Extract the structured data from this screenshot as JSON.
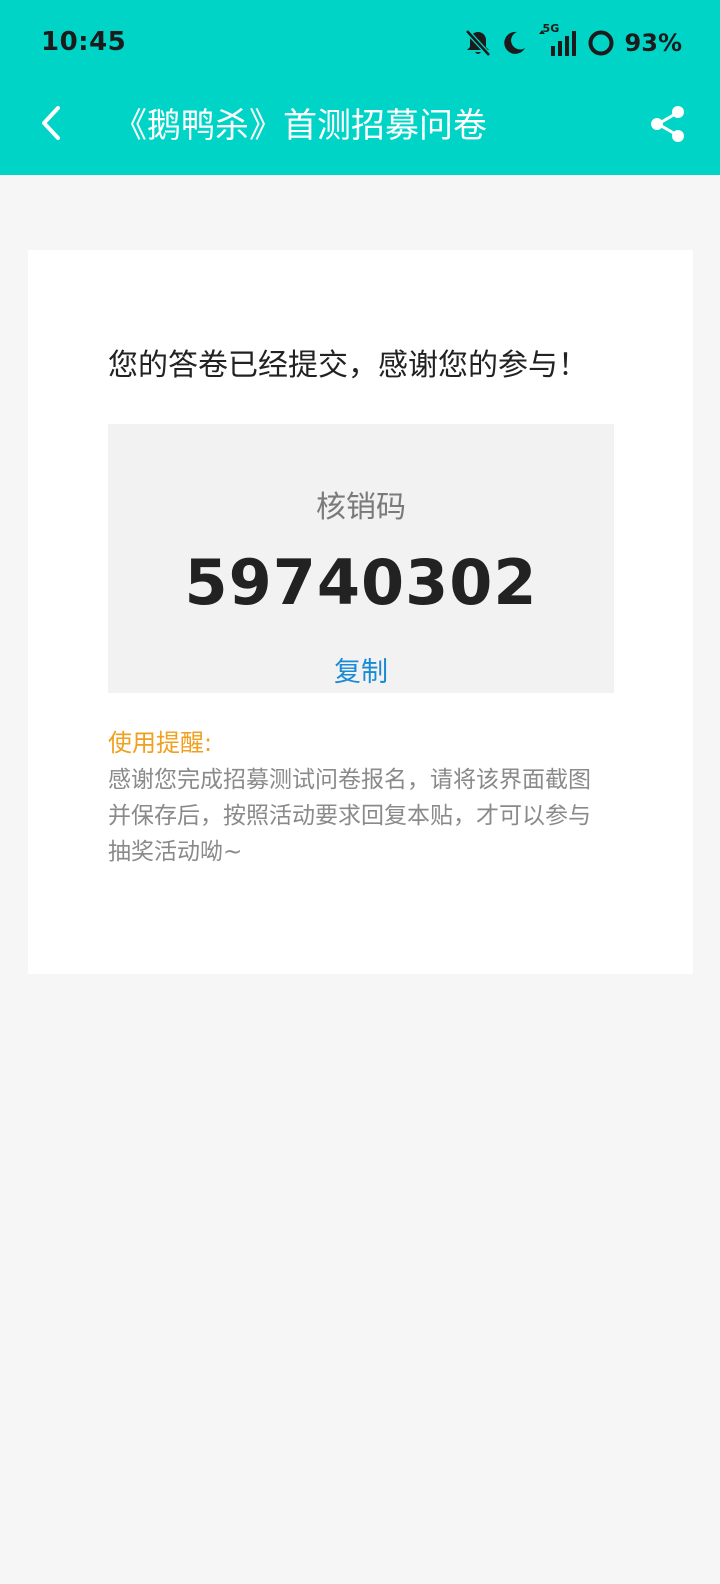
{
  "status_bar": {
    "time": "10:45",
    "network": "5G",
    "battery": "93%"
  },
  "nav": {
    "title": "《鹅鸭杀》首测招募问卷"
  },
  "card": {
    "headline": "您的答卷已经提交，感谢您的参与！",
    "code_label": "核销码",
    "code_value": "59740302",
    "copy_label": "复制",
    "reminder_title": "使用提醒:",
    "reminder_body": "感谢您完成招募测试问卷报名，请将该界面截图并保存后，按照活动要求回复本贴，才可以参与抽奖活动呦~"
  },
  "colors": {
    "header_bg": "#00d4c7",
    "page_bg": "#f6f6f6",
    "link": "#1a8ad6",
    "reminder_title": "#f0a01e"
  },
  "icons": {
    "back": "back-arrow-icon",
    "share": "share-icon",
    "bell_off": "bell-off-icon",
    "moon": "moon-icon",
    "signal": "signal-icon",
    "battery": "battery-ring-icon"
  }
}
